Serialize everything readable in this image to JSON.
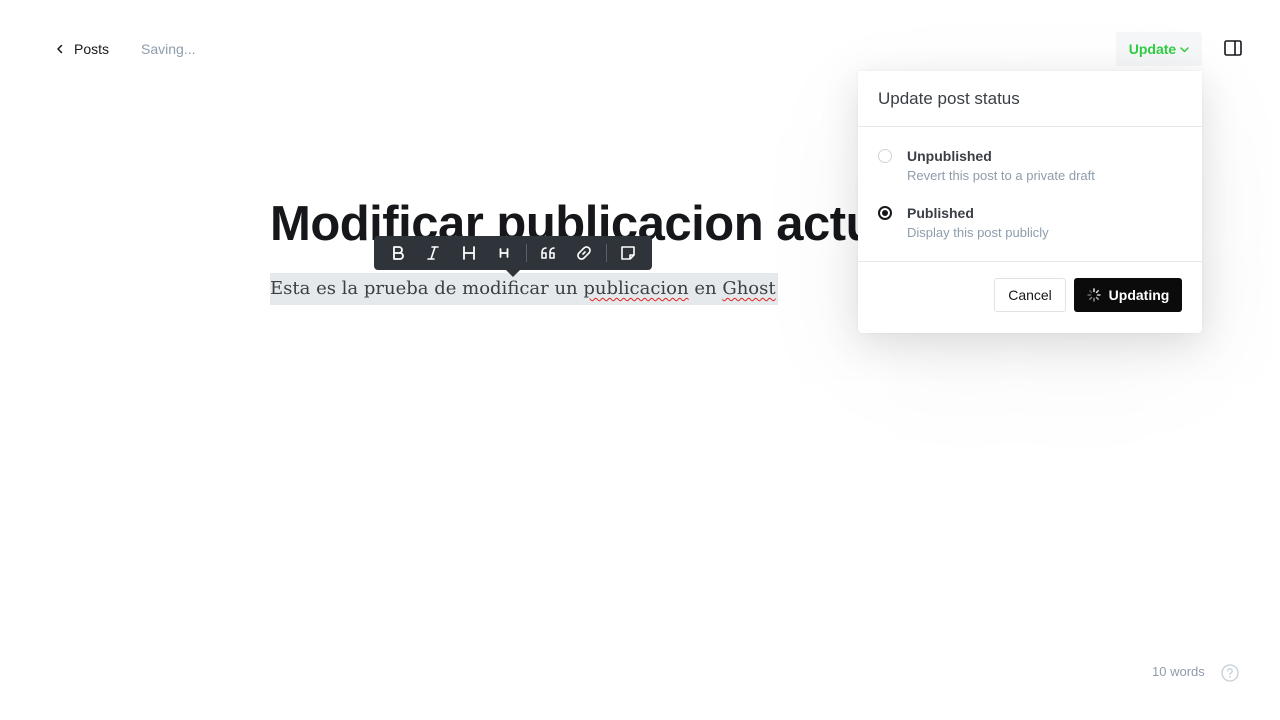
{
  "header": {
    "back_label": "Posts",
    "status": "Saving...",
    "update_label": "Update"
  },
  "editor": {
    "title": "Modificar publicacion actual",
    "body_segments": [
      "Esta es la prueba de modificar un ",
      "publicacion",
      " en ",
      "Ghost"
    ],
    "word_count": "10 words"
  },
  "toolbar": {
    "items": [
      "bold",
      "italic",
      "heading-2",
      "heading-3",
      "quote",
      "link",
      "snippet"
    ]
  },
  "popover": {
    "title": "Update post status",
    "options": [
      {
        "label": "Unpublished",
        "description": "Revert this post to a private draft",
        "selected": false
      },
      {
        "label": "Published",
        "description": "Display this post publicly",
        "selected": true
      }
    ],
    "cancel_label": "Cancel",
    "confirm_label": "Updating"
  },
  "colors": {
    "accent_green": "#30cf43",
    "toolbar_bg": "#2f343a",
    "primary_button": "#0b0b0b"
  }
}
